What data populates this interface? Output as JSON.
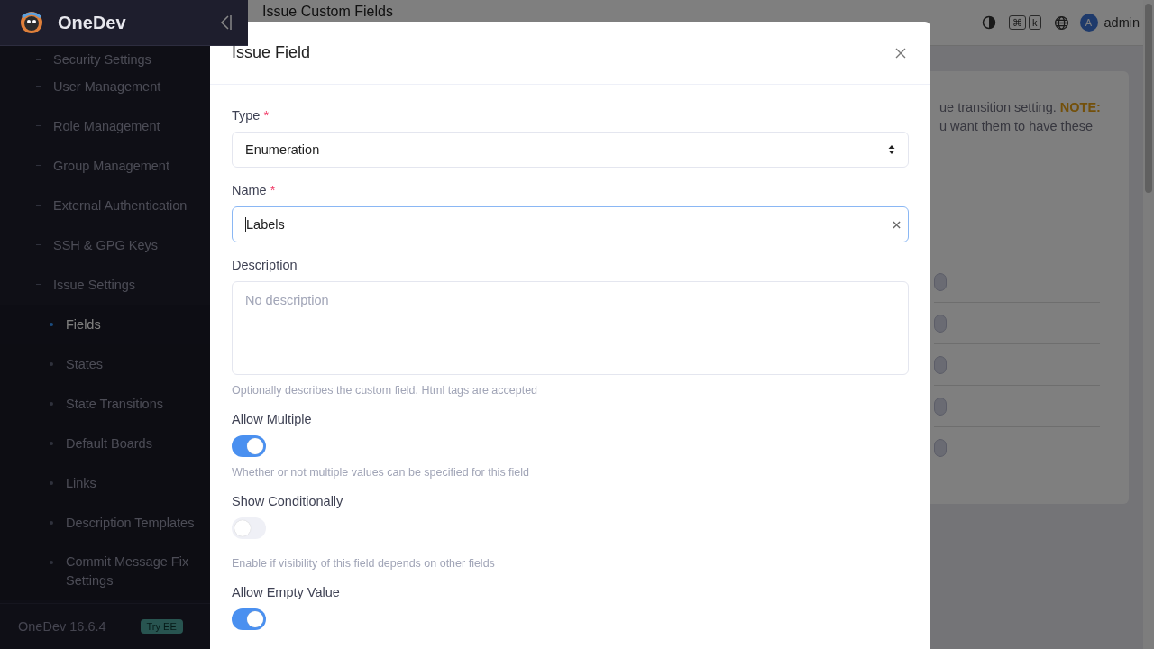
{
  "app": {
    "name": "OneDev",
    "version": "OneDev 16.6.4",
    "badge": "Try EE"
  },
  "sidebar": {
    "items": [
      {
        "label": "Security Settings",
        "selected": false
      },
      {
        "label": "User Management",
        "selected": false
      },
      {
        "label": "Role Management",
        "selected": false
      },
      {
        "label": "Group Management",
        "selected": false
      },
      {
        "label": "External Authentication",
        "selected": false
      },
      {
        "label": "SSH & GPG Keys",
        "selected": false
      },
      {
        "label": "Issue Settings",
        "selected": false,
        "children": [
          {
            "label": "Fields",
            "selected": true
          },
          {
            "label": "States",
            "selected": false
          },
          {
            "label": "State Transitions",
            "selected": false
          },
          {
            "label": "Default Boards",
            "selected": false
          },
          {
            "label": "Links",
            "selected": false
          },
          {
            "label": "Description Templates",
            "selected": false
          },
          {
            "label": "Commit Message Fix Settings",
            "selected": false
          }
        ]
      }
    ]
  },
  "header": {
    "title": "Issue Custom Fields",
    "shortcut_keys": [
      "⌘",
      "k"
    ],
    "avatar": "A",
    "user": "admin"
  },
  "background_card": {
    "lines": [
      "ue transition setting. **NOTE:**",
      "u want them to have these"
    ]
  },
  "dialog": {
    "title": "Issue Field",
    "required_mark": "*",
    "fields": [
      {
        "kind": "select",
        "label": "Type",
        "required": true,
        "value": "Enumeration"
      },
      {
        "kind": "text",
        "label": "Name",
        "required": true,
        "value": "Labels",
        "focused": true
      },
      {
        "kind": "textarea",
        "label": "Description",
        "required": false,
        "placeholder": "No description",
        "help": "Optionally describes the custom field. Html tags are accepted"
      },
      {
        "kind": "toggle",
        "label": "Allow Multiple",
        "required": false,
        "on": true,
        "help": "Whether or not multiple values can be specified for this field"
      },
      {
        "kind": "toggle",
        "label": "Show Conditionally",
        "required": false,
        "on": false,
        "help": "Enable if visibility of this field depends on other fields"
      },
      {
        "kind": "toggle",
        "label": "Allow Empty Value",
        "required": false,
        "on": true
      }
    ]
  }
}
